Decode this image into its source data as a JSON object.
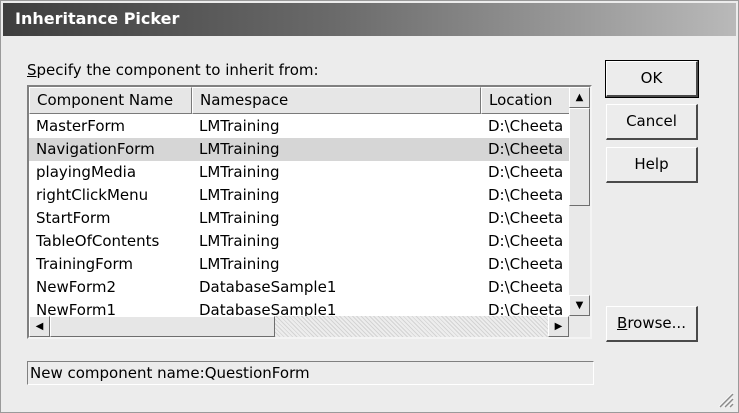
{
  "window": {
    "title": "Inheritance Picker"
  },
  "prompt": {
    "accesskey": "S",
    "rest": "pecify the component to inherit from:"
  },
  "columns": [
    "Component Name",
    "Namespace",
    "Location"
  ],
  "rows": [
    {
      "name": "MasterForm",
      "namespace": "LMTraining",
      "location": "D:\\Cheeta"
    },
    {
      "name": "NavigationForm",
      "namespace": "LMTraining",
      "location": "D:\\Cheeta"
    },
    {
      "name": "playingMedia",
      "namespace": "LMTraining",
      "location": "D:\\Cheeta"
    },
    {
      "name": "rightClickMenu",
      "namespace": "LMTraining",
      "location": "D:\\Cheeta"
    },
    {
      "name": "StartForm",
      "namespace": "LMTraining",
      "location": "D:\\Cheeta"
    },
    {
      "name": "TableOfContents",
      "namespace": "LMTraining",
      "location": "D:\\Cheeta"
    },
    {
      "name": "TrainingForm",
      "namespace": "LMTraining",
      "location": "D:\\Cheeta"
    },
    {
      "name": "NewForm2",
      "namespace": "DatabaseSample1",
      "location": "D:\\Cheeta"
    },
    {
      "name": "NewForm1",
      "namespace": "DatabaseSample1",
      "location": "D:\\Cheeta"
    }
  ],
  "selected_row": 1,
  "buttons": {
    "ok": "OK",
    "cancel": "Cancel",
    "help": "Help",
    "browse_accesskey": "B",
    "browse_rest": "rowse..."
  },
  "status": "New component name:QuestionForm",
  "icons": {
    "scroll_up": "scroll-up-arrow-icon",
    "scroll_down": "scroll-down-arrow-icon",
    "scroll_left": "scroll-left-arrow-icon",
    "scroll_right": "scroll-right-arrow-icon",
    "resize": "resize-grip-icon"
  }
}
